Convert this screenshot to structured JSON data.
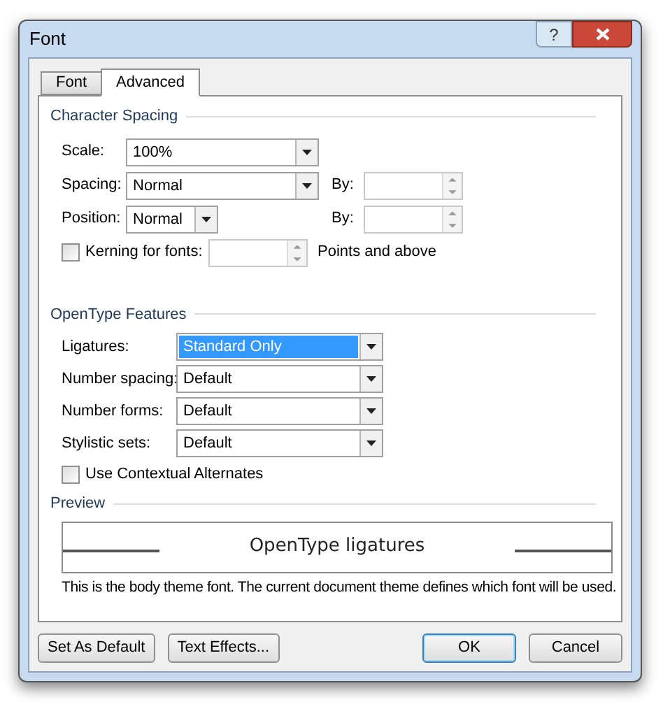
{
  "window": {
    "title": "Font",
    "help": "?"
  },
  "tabs": [
    {
      "label": "Font",
      "selected": false
    },
    {
      "label": "Advanced",
      "selected": true
    }
  ],
  "character_spacing": {
    "heading": "Character Spacing",
    "rows": [
      {
        "kind": "select",
        "label": "Scale:",
        "value": "100%"
      },
      {
        "kind": "select_by",
        "label": "Spacing:",
        "value": "Normal",
        "by_label": "By:"
      },
      {
        "kind": "short_select_by",
        "label": "Position:",
        "value": "Normal",
        "by_label": "By:"
      },
      {
        "kind": "checkbox_spin",
        "label": "Kerning for fonts:",
        "checked": false,
        "suffix": "Points and above"
      }
    ]
  },
  "opentype_features": {
    "heading": "OpenType Features",
    "selects": [
      {
        "label": "Ligatures:",
        "value": "Standard Only",
        "selected": true
      },
      {
        "label": "Number spacing:",
        "value": "Default",
        "selected": false
      },
      {
        "label": "Number forms:",
        "value": "Default",
        "selected": false
      },
      {
        "label": "Stylistic sets:",
        "value": "Default",
        "selected": false
      }
    ],
    "checkbox": {
      "label": "Use Contextual Alternates",
      "checked": false
    }
  },
  "preview": {
    "heading": "Preview",
    "sample": "OpenType ligatures",
    "description": "This is the body theme font. The current document theme defines which font will be used."
  },
  "buttons": [
    {
      "label": "Set As Default",
      "default": false
    },
    {
      "label": "Text Effects...",
      "default": false
    },
    {
      "label": "OK",
      "default": true
    },
    {
      "label": "Cancel",
      "default": false
    }
  ]
}
